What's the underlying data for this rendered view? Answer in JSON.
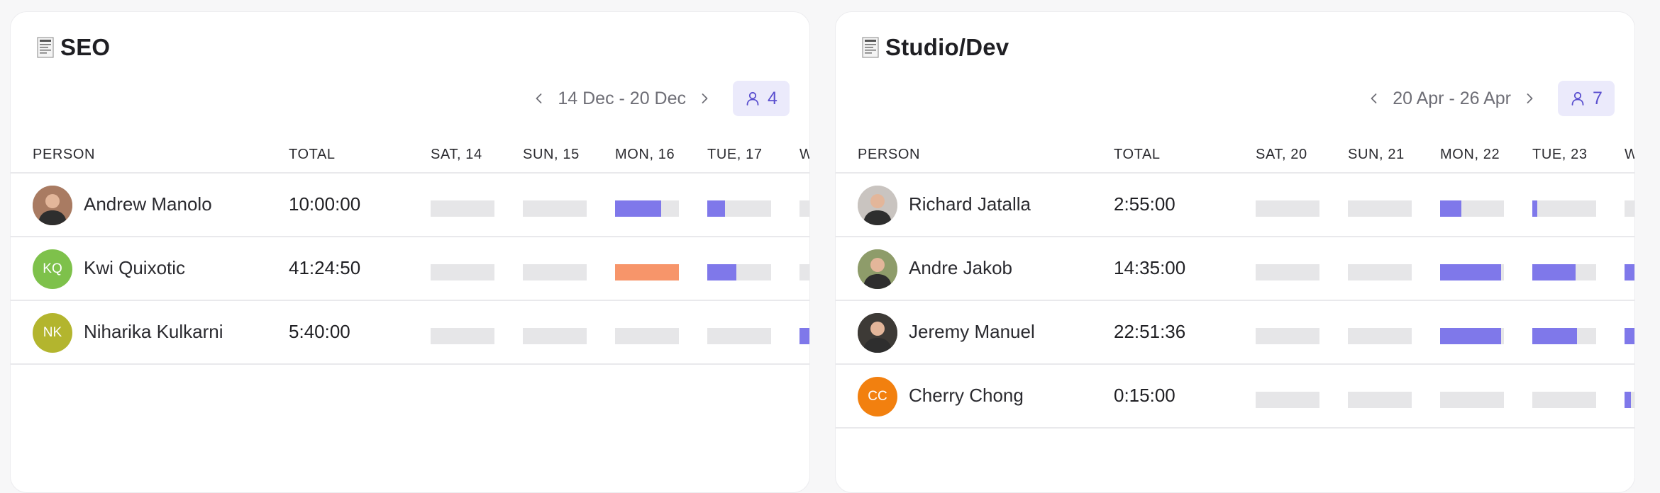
{
  "panels": [
    {
      "title": "SEO",
      "date_range": "14 Dec - 20 Dec",
      "member_count": "4",
      "columns": {
        "person": "PERSON",
        "total": "TOTAL",
        "days": [
          "SAT, 14",
          "SUN, 15",
          "MON, 16",
          "TUE, 17",
          "W"
        ]
      },
      "rows": [
        {
          "name": "Andrew Manolo",
          "initials": "",
          "avatar": "photo",
          "avatar_color": "#a97b62",
          "total": "10:00:00",
          "day_fill": [
            0,
            0,
            0.72,
            0.28,
            0
          ]
        },
        {
          "name": "Kwi Quixotic",
          "initials": "KQ",
          "avatar": "initials",
          "avatar_color": "#7ec14b",
          "total": "41:24:50",
          "day_fill": [
            0,
            0,
            1.0,
            0.45,
            0
          ],
          "over_day": 2
        },
        {
          "name": "Niharika Kulkarni",
          "initials": "NK",
          "avatar": "initials",
          "avatar_color": "#b3b52e",
          "total": "5:40:00",
          "day_fill": [
            0,
            0,
            0,
            0,
            0.4
          ]
        }
      ]
    },
    {
      "title": "Studio/Dev",
      "date_range": "20 Apr - 26 Apr",
      "member_count": "7",
      "columns": {
        "person": "PERSON",
        "total": "TOTAL",
        "days": [
          "SAT, 20",
          "SUN, 21",
          "MON, 22",
          "TUE, 23",
          "W"
        ]
      },
      "rows": [
        {
          "name": "Richard Jatalla",
          "initials": "",
          "avatar": "photo",
          "avatar_color": "#c9c4c0",
          "total": "2:55:00",
          "day_fill": [
            0,
            0,
            0.33,
            0.08,
            0
          ]
        },
        {
          "name": "Andre Jakob",
          "initials": "",
          "avatar": "photo",
          "avatar_color": "#8e9c6a",
          "total": "14:35:00",
          "day_fill": [
            0,
            0,
            0.95,
            0.68,
            0.4
          ]
        },
        {
          "name": "Jeremy Manuel",
          "initials": "",
          "avatar": "photo",
          "avatar_color": "#3d3a36",
          "total": "22:51:36",
          "day_fill": [
            0,
            0,
            0.95,
            0.7,
            0.4
          ]
        },
        {
          "name": "Cherry Chong",
          "initials": "CC",
          "avatar": "initials",
          "avatar_color": "#f2800f",
          "total": "0:15:00",
          "day_fill": [
            0,
            0,
            0,
            0,
            0.1
          ]
        }
      ]
    }
  ],
  "colors": {
    "accent": "#7f78ea",
    "overtime": "#f7956a",
    "empty_bar": "#e6e6e8",
    "badge_bg": "#ebeafb",
    "badge_text": "#5a4fcf"
  }
}
